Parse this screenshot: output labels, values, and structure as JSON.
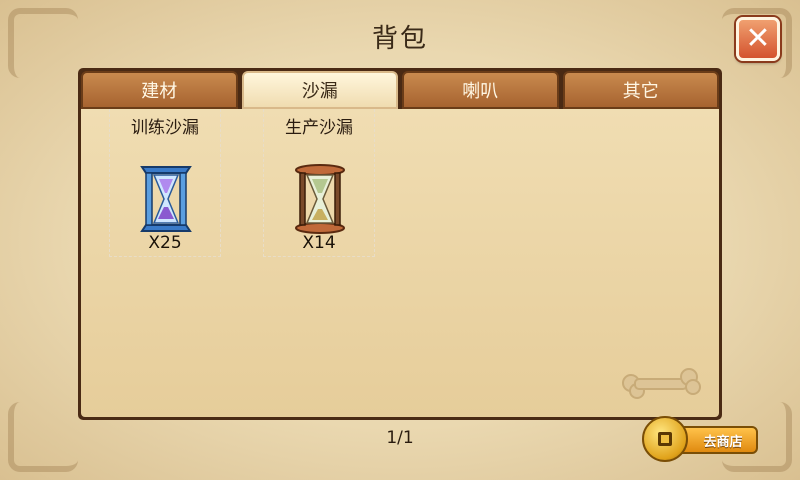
{
  "title": "背包",
  "tabs": [
    {
      "label": "建材",
      "active": false
    },
    {
      "label": "沙漏",
      "active": true
    },
    {
      "label": "喇叭",
      "active": false
    },
    {
      "label": "其它",
      "active": false
    }
  ],
  "items": [
    {
      "name": "训练沙漏",
      "count": "X25",
      "icon": "blue-hourglass-icon"
    },
    {
      "name": "生产沙漏",
      "count": "X14",
      "icon": "brown-hourglass-icon"
    }
  ],
  "pager": {
    "text": "1/1"
  },
  "shop_button": {
    "label": "去商店",
    "icon": "coin-icon"
  },
  "close_button": {
    "icon": "close-icon"
  },
  "colors": {
    "close": "#d4532e",
    "tab_active": "#fff6dc",
    "tab_inactive": "#b5713a",
    "panel_border": "#4a2a14",
    "shop": "#f0a020"
  }
}
